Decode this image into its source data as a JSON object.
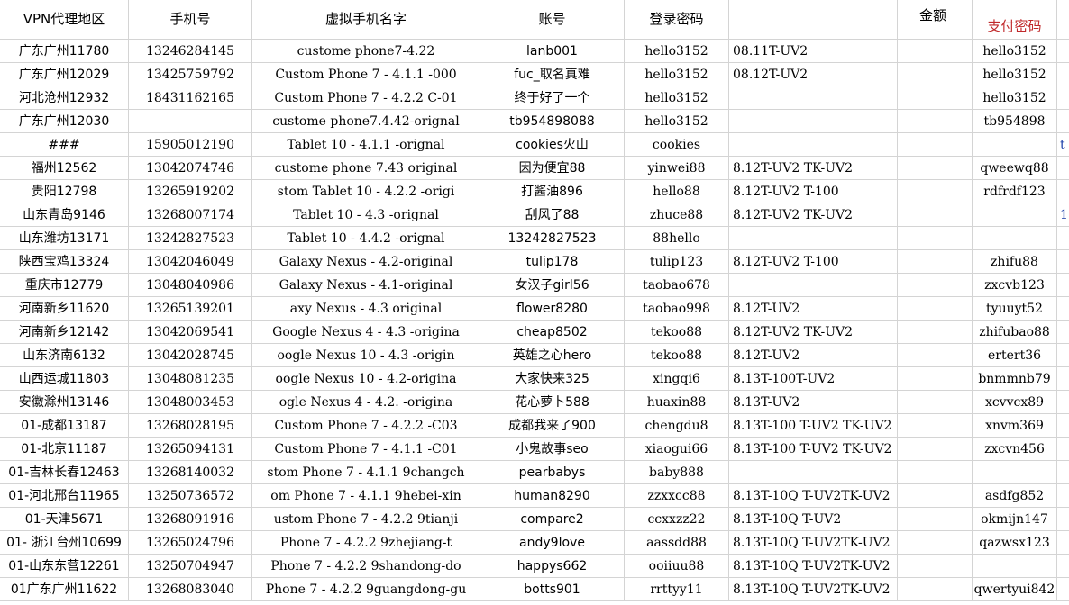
{
  "headers": [
    "VPN代理地区",
    "手机号",
    "虚拟手机名字",
    "账号",
    "登录密码",
    "",
    "金额",
    "支付密码"
  ],
  "rows": [
    [
      "广东广州11780",
      "13246284145",
      "custome phone7-4.22",
      "lanb001",
      "hello3152",
      "08.11T-UV2",
      "",
      "hello3152",
      ""
    ],
    [
      "广东广州12029",
      "13425759792",
      "Custom Phone 7 - 4.1.1 -000",
      "fuc_取名真难",
      "hello3152",
      "08.12T-UV2",
      "",
      "hello3152",
      ""
    ],
    [
      "河北沧州12932",
      "18431162165",
      "Custom Phone 7 - 4.2.2 C-01",
      "终于好了一个",
      "hello3152",
      "",
      "",
      "hello3152",
      ""
    ],
    [
      "广东广州12030",
      "",
      "custome phone7.4.42-orignal",
      "tb954898088",
      "hello3152",
      "",
      "",
      "tb954898",
      ""
    ],
    [
      "###",
      "15905012190",
      "Tablet 10 - 4.1.1 -orignal",
      "cookies火山",
      "cookies",
      "",
      "",
      "",
      "t"
    ],
    [
      "福州12562",
      "13042074746",
      "custome phone 7.43 original",
      "因为便宜88",
      "yinwei88",
      "8.12T-UV2 TK-UV2",
      "",
      "qweewq88",
      ""
    ],
    [
      "贵阳12798",
      "13265919202",
      "stom Tablet 10 - 4.2.2 -origi",
      "打酱油896",
      "hello88",
      "8.12T-UV2 T-100",
      "",
      "rdfrdf123",
      ""
    ],
    [
      "山东青岛9146",
      "13268007174",
      "Tablet 10 - 4.3 -orignal",
      "刮风了88",
      "zhuce88",
      "8.12T-UV2 TK-UV2",
      "",
      "",
      "1"
    ],
    [
      "山东潍坊13171",
      "13242827523",
      "Tablet 10 - 4.4.2 -orignal",
      "13242827523",
      "88hello",
      "",
      "",
      "",
      ""
    ],
    [
      "陕西宝鸡13324",
      "13042046049",
      "Galaxy Nexus - 4.2-original",
      "tulip178",
      "tulip123",
      "8.12T-UV2 T-100",
      "",
      "zhifu88",
      ""
    ],
    [
      "重庆市12779",
      "13048040986",
      "Galaxy Nexus - 4.1-original",
      "女汉子girl56",
      "taobao678",
      "",
      "",
      "zxcvb123",
      ""
    ],
    [
      "河南新乡11620",
      "13265139201",
      "axy Nexus - 4.3 original",
      "flower8280",
      "taobao998",
      "8.12T-UV2",
      "",
      "tyuuyt52",
      ""
    ],
    [
      "河南新乡12142",
      "13042069541",
      "Google Nexus 4 - 4.3 -origina",
      "cheap8502",
      "tekoo88",
      "8.12T-UV2 TK-UV2",
      "",
      "zhifubao88",
      ""
    ],
    [
      "山东济南6132",
      "13042028745",
      "oogle Nexus 10 - 4.3 -origin",
      "英雄之心hero",
      "tekoo88",
      "8.12T-UV2",
      "",
      "ertert36",
      ""
    ],
    [
      "山西运城11803",
      "13048081235",
      "oogle Nexus 10 - 4.2-origina",
      "大家快来325",
      "xingqi6",
      "8.13T-100T-UV2",
      "",
      "bnmmnb79",
      ""
    ],
    [
      "安徽滁州13146",
      "13048003453",
      "ogle Nexus 4 - 4.2. -origina",
      "花心萝卜588",
      "huaxin88",
      "8.13T-UV2",
      "",
      "xcvvcx89",
      ""
    ],
    [
      "01-成都13187",
      "13268028195",
      "Custom Phone 7 - 4.2.2 -C03",
      "成都我来了900",
      "chengdu8",
      "8.13T-100 T-UV2 TK-UV2",
      "",
      "xnvm369",
      ""
    ],
    [
      "01-北京11187",
      "13265094131",
      "Custom Phone 7 - 4.1.1 -C01",
      "小鬼故事seo",
      "xiaogui66",
      "8.13T-100 T-UV2 TK-UV2",
      "",
      "zxcvn456",
      ""
    ],
    [
      "01-吉林长春12463",
      "13268140032",
      "stom Phone 7 - 4.1.1 9changch",
      "pearbabys",
      "baby888",
      "",
      "",
      "",
      ""
    ],
    [
      "01-河北邢台11965",
      "13250736572",
      "om Phone 7 - 4.1.1 9hebei-xin",
      "human8290",
      "zzxxcc88",
      "8.13T-10Q T-UV2TK-UV2",
      "",
      "asdfg852",
      ""
    ],
    [
      "01-天津5671",
      "13268091916",
      "ustom Phone 7 - 4.2.2 9tianji",
      "compare2",
      "ccxxzz22",
      "8.13T-10Q T-UV2",
      "",
      "okmijn147",
      ""
    ],
    [
      "01- 浙江台州10699",
      "13265024796",
      "Phone 7 - 4.2.2 9zhejiang-t",
      "andy9love",
      "aassdd88",
      "8.13T-10Q T-UV2TK-UV2",
      "",
      "qazwsx123",
      ""
    ],
    [
      "01-山东东营12261",
      "13250704947",
      "Phone 7 - 4.2.2 9shandong-do",
      "happys662",
      "ooiiuu88",
      "8.13T-10Q T-UV2TK-UV2",
      "",
      "",
      ""
    ],
    [
      "01广东广州11622",
      "13268083040",
      "Phone 7 - 4.2.2 9guangdong-gu",
      "botts901",
      "rrttyy11",
      "8.13T-10Q T-UV2TK-UV2",
      "",
      "qwertyui842",
      ""
    ]
  ],
  "colors": {
    "grid": "#d4d4d4",
    "header_pay": "#c0282a",
    "link": "#1a3ea8"
  }
}
